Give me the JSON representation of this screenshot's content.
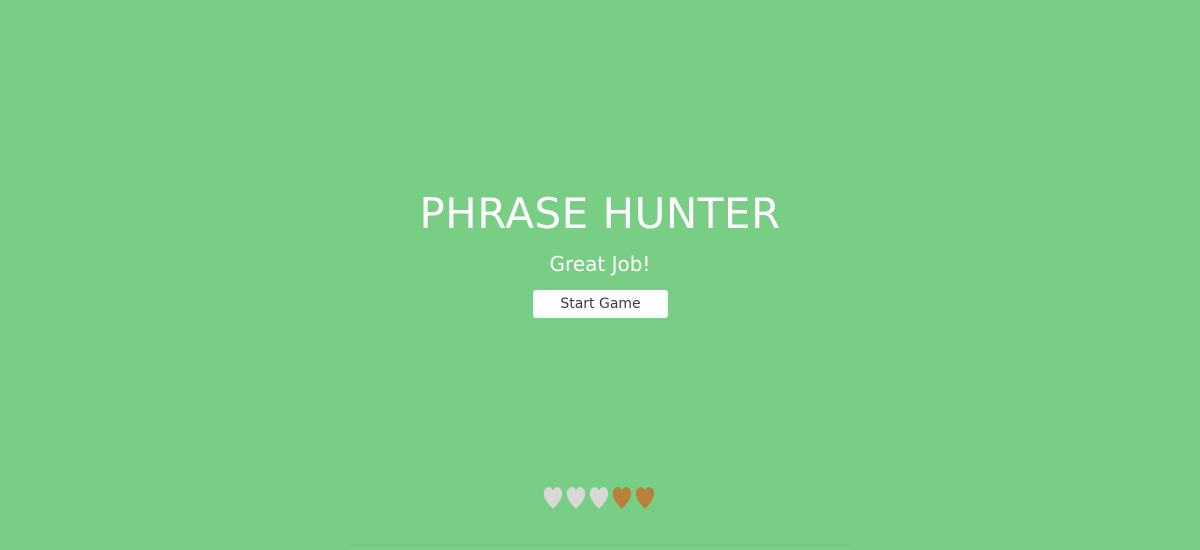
{
  "game": {
    "title": "PHRASE HUNTER",
    "message": "Great Job!",
    "start_button_label": "Start Game"
  },
  "scoreboard": {
    "lives": [
      {
        "icon": "lost-heart-icon",
        "state": "lost"
      },
      {
        "icon": "lost-heart-icon",
        "state": "lost"
      },
      {
        "icon": "lost-heart-icon",
        "state": "lost"
      },
      {
        "icon": "live-heart-icon",
        "state": "live"
      },
      {
        "icon": "live-heart-icon",
        "state": "live"
      }
    ]
  },
  "colors": {
    "background": "#78ce85",
    "text": "#ffffff",
    "button_background": "#ffffff",
    "button_text": "#3a3a4a",
    "heart_lost": "#d8d8d8",
    "heart_live": "#b9803a"
  }
}
